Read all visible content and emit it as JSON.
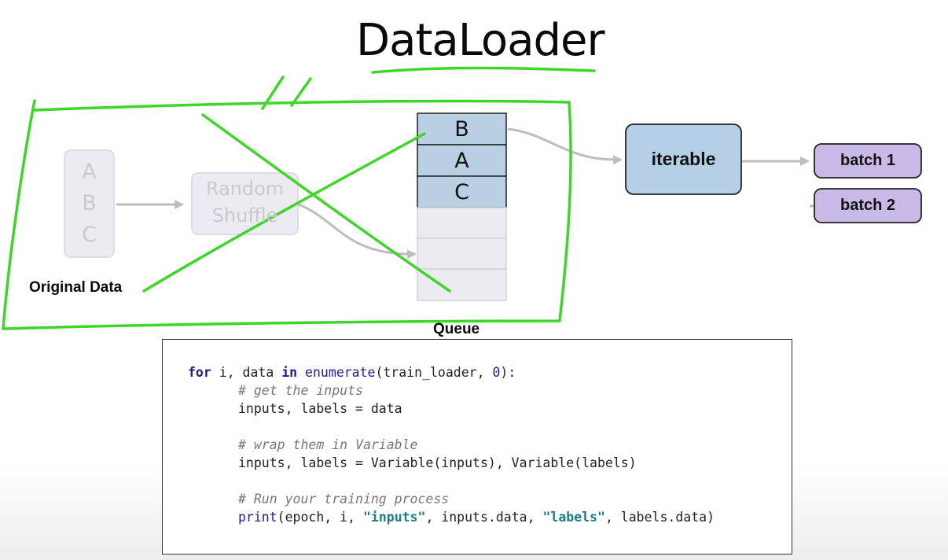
{
  "title": "DataLoader",
  "original_data": {
    "letters": [
      "A",
      "B",
      "C"
    ],
    "caption": "Original Data"
  },
  "shuffle": {
    "line1": "Random",
    "line2": "Shuffle"
  },
  "queue": {
    "caption": "Queue",
    "cells": [
      "B",
      "A",
      "C"
    ]
  },
  "iterable": {
    "label": "iterable"
  },
  "batches": [
    "batch 1",
    "batch 2"
  ],
  "code": {
    "line1": {
      "kw1": "for",
      "t1": " i, data ",
      "kw2": "in",
      "t2": " ",
      "fn": "enumerate",
      "t3": "(train_loader, ",
      "num": "0",
      "t4": "):"
    },
    "line2": "# get the inputs",
    "line3": "inputs, labels = data",
    "line4": "# wrap them in Variable",
    "line5": "inputs, labels = Variable(inputs), Variable(labels)",
    "line6": "# Run your training process",
    "line7": {
      "fn": "print",
      "t1": "(epoch, i, ",
      "s1": "\"inputs\"",
      "t2": ", inputs.data, ",
      "s2": "\"labels\"",
      "t3": ", labels.data)"
    }
  },
  "colors": {
    "annotation": "#3fd62a",
    "queue_fill": "#b9cfe3",
    "iterable_fill": "#b5d0e6",
    "batch_fill": "#c8b9e6",
    "arrow": "#bdbdbd"
  }
}
